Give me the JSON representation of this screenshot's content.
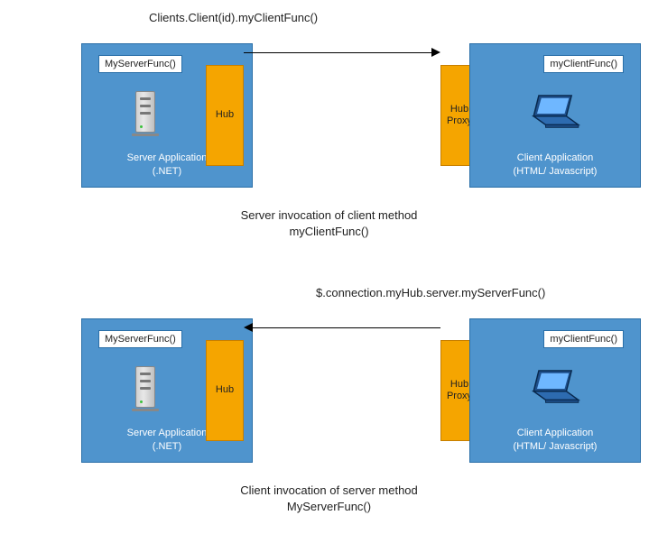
{
  "diagrams": [
    {
      "code_line": "Clients.Client(id).myClientFunc()",
      "server": {
        "func_label": "MyServerFunc()",
        "app_label_1": "Server Application",
        "app_label_2": "(.NET)"
      },
      "hub_label": "Hub",
      "hub_proxy_label_1": "Hub",
      "hub_proxy_label_2": "Proxy",
      "client": {
        "func_label": "myClientFunc()",
        "app_label_1": "Client Application",
        "app_label_2": "(HTML/ Javascript)"
      },
      "direction": "right",
      "caption_1": "Server invocation of client method",
      "caption_2": "myClientFunc()"
    },
    {
      "code_line": "$.connection.myHub.server.myServerFunc()",
      "server": {
        "func_label": "MyServerFunc()",
        "app_label_1": "Server Application",
        "app_label_2": "(.NET)"
      },
      "hub_label": "Hub",
      "hub_proxy_label_1": "Hub",
      "hub_proxy_label_2": "Proxy",
      "client": {
        "func_label": "myClientFunc()",
        "app_label_1": "Client Application",
        "app_label_2": "(HTML/ Javascript)"
      },
      "direction": "left",
      "caption_1": "Client invocation of server method",
      "caption_2": "MyServerFunc()"
    }
  ],
  "colors": {
    "box_fill": "#4f94cd",
    "box_border": "#2a6fa8",
    "hub_fill": "#f5a500",
    "hub_border": "#c77f00"
  }
}
